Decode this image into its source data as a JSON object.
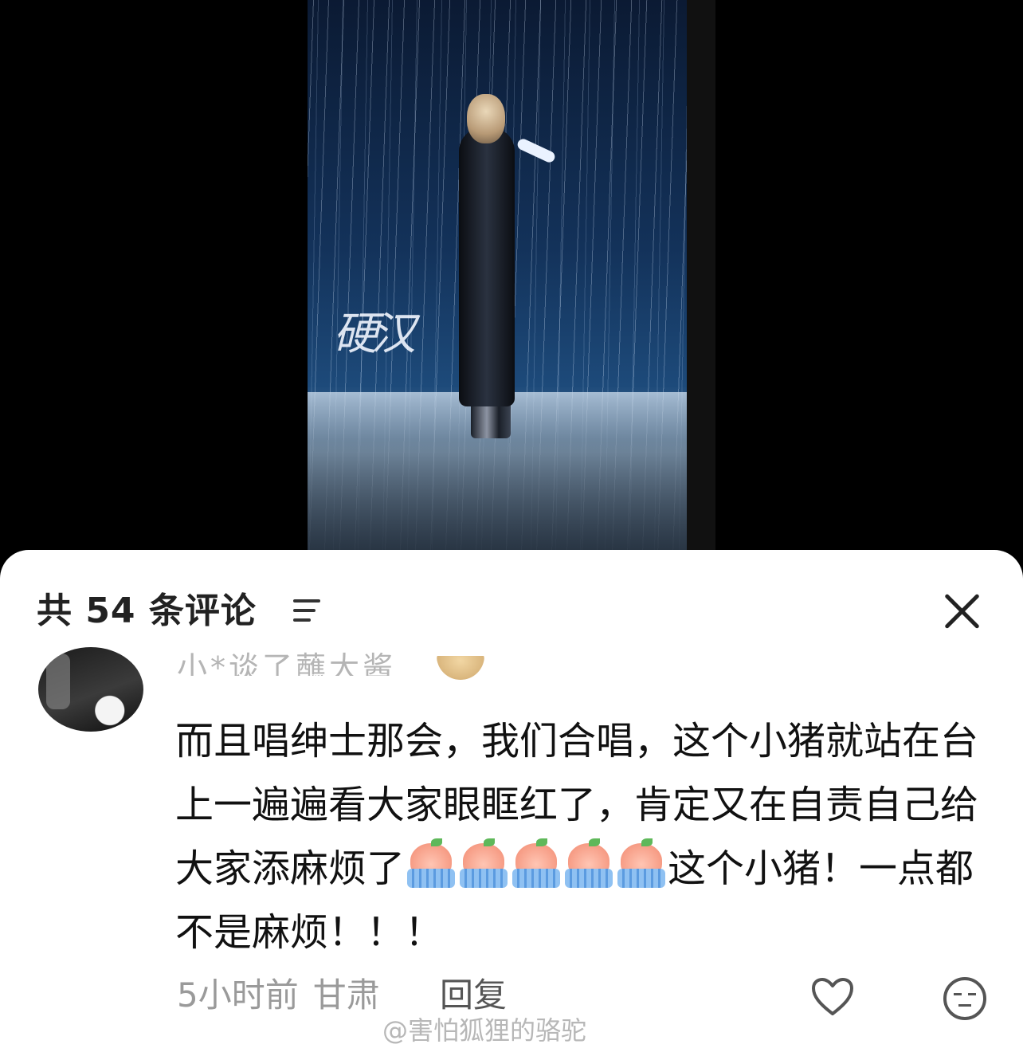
{
  "header": {
    "comment_count_label": "共 54 条评论"
  },
  "comment": {
    "username": "小*谈了蘸大酱",
    "text_part1": "而且唱绅士那会，我们合唱，这个小猪就站在台上一遍遍看大家眼眶红了，肯定又在自责自己给大家添麻烦了",
    "text_part2": "这个小猪！一点都不是麻烦！！！",
    "time": "5小时前",
    "location": "甘肃",
    "reply_label": "回复"
  },
  "video": {
    "overlay_logo_text": "硬汉"
  },
  "watermark": "@害怕狐狸的骆驼",
  "icons": [
    "sort-icon",
    "close-icon",
    "like-icon",
    "mood-icon",
    "crying-pig-emoji"
  ]
}
